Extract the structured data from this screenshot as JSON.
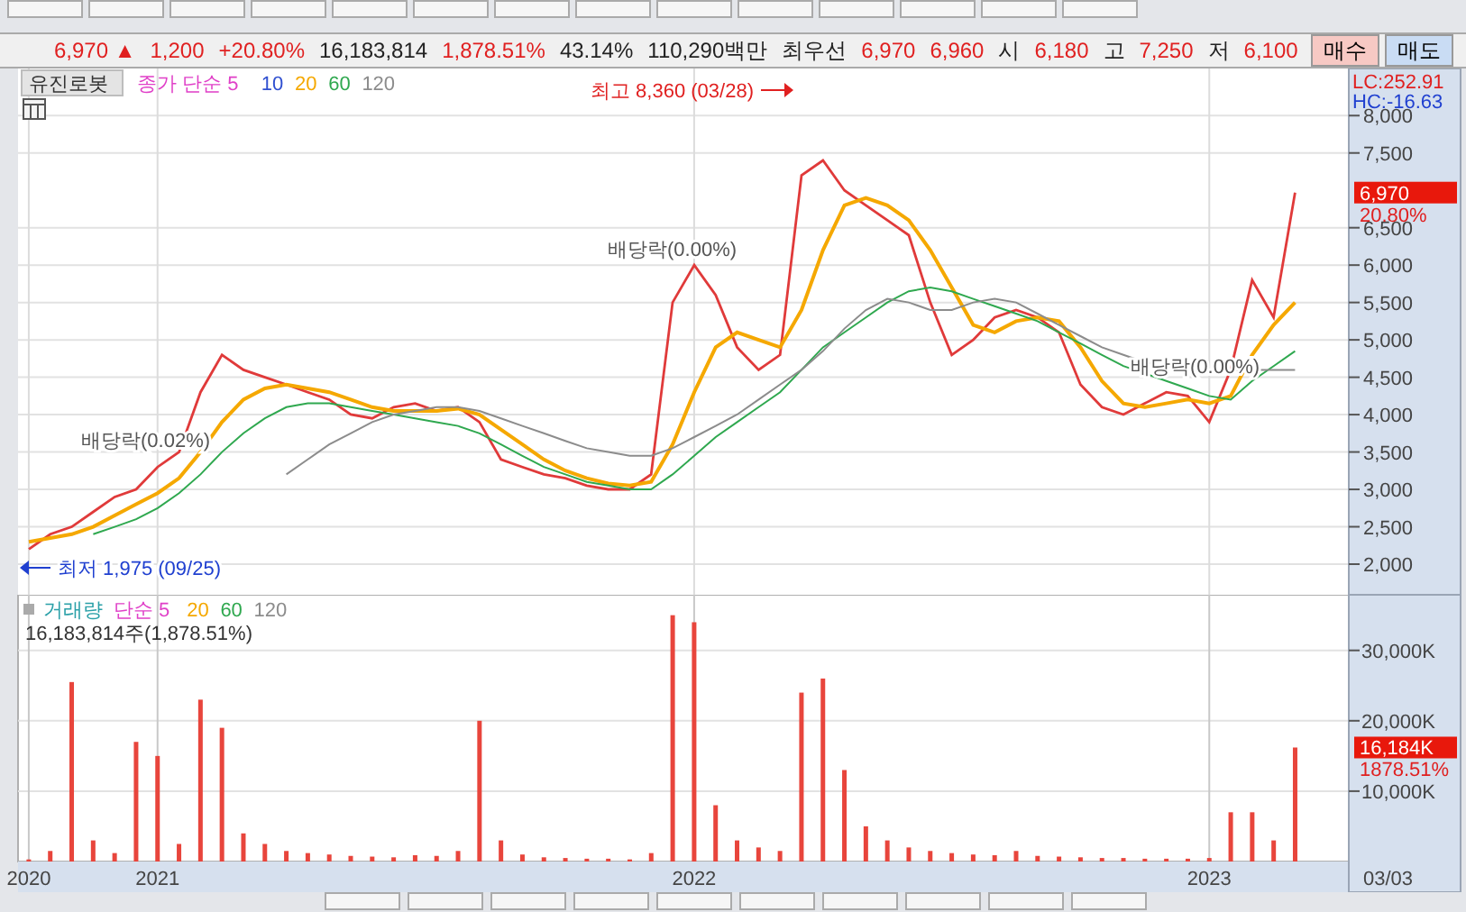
{
  "quote": {
    "price": "6,970",
    "direction": "▲",
    "change": "1,200",
    "change_pct": "+20.80%",
    "volume": "16,183,814",
    "volume_pct": "1,878.51%",
    "turnover": "43.14%",
    "amount": "110,290백만",
    "best_label": "최우선",
    "ask": "6,970",
    "bid": "6,960",
    "open_label": "시",
    "open": "6,180",
    "high_label": "고",
    "high": "7,250",
    "low_label": "저",
    "low": "6,100"
  },
  "buttons": [
    {
      "label": "매수",
      "kind": "buy"
    },
    {
      "label": "매도",
      "kind": "sell"
    }
  ],
  "price_panel": {
    "symbol": "유진로봇",
    "legend": [
      {
        "label": "종가 단순 5",
        "color": "#e040c8"
      },
      {
        "label": "10",
        "color": "#3050d0"
      },
      {
        "label": "20",
        "color": "#f5a800"
      },
      {
        "label": "60",
        "color": "#2fa84f"
      },
      {
        "label": "120",
        "color": "#8c8c8c"
      }
    ],
    "lc": "LC:252.91",
    "hc": "HC:-16.63",
    "last_price_tag": "6,970",
    "last_change_tag": "20.80%",
    "chart_data": {
      "type": "line",
      "grid": true,
      "categories": [
        null,
        null,
        null,
        null,
        null,
        null,
        null,
        null,
        null,
        null,
        null,
        null,
        null,
        null,
        null,
        null,
        null,
        null,
        null,
        null,
        null,
        null,
        null,
        null,
        null,
        null,
        null,
        null,
        null,
        null,
        null,
        null,
        null,
        null,
        null,
        null,
        null,
        null,
        null,
        null,
        null,
        null,
        null,
        null,
        null,
        null,
        null,
        null,
        null,
        null,
        null,
        null,
        null,
        null,
        null,
        null,
        null,
        null,
        null,
        null,
        null,
        null
      ],
      "ylim": [
        1590,
        8630
      ],
      "yticks": [
        {
          "value": 2000,
          "label": "2,000"
        },
        {
          "value": 2500,
          "label": "2,500"
        },
        {
          "value": 3000,
          "label": "3,000"
        },
        {
          "value": 3500,
          "label": "3,500"
        },
        {
          "value": 4000,
          "label": "4,000"
        },
        {
          "value": 4500,
          "label": "4,500"
        },
        {
          "value": 5000,
          "label": "5,000"
        },
        {
          "value": 5500,
          "label": "5,500"
        },
        {
          "value": 6000,
          "label": "6,000"
        },
        {
          "value": 6500,
          "label": "6,500"
        },
        {
          "value": 7500,
          "label": "7,500"
        },
        {
          "value": 8000,
          "label": "8,000"
        }
      ],
      "series": [
        {
          "color": "#e03a3a",
          "values": [
            2200,
            2400,
            2500,
            2700,
            2900,
            3000,
            3300,
            3500,
            4300,
            4800,
            4600,
            4500,
            4400,
            4300,
            4200,
            4000,
            3950,
            4100,
            4150,
            4050,
            4100,
            3900,
            3400,
            3300,
            3200,
            3150,
            3050,
            3000,
            3000,
            3200,
            5500,
            6000,
            5600,
            4900,
            4600,
            4800,
            7200,
            7400,
            7000,
            6800,
            6600,
            6400,
            5500,
            4800,
            5000,
            5300,
            5400,
            5300,
            5100,
            4400,
            4100,
            4000,
            4150,
            4300,
            4250,
            3900,
            4600,
            5800,
            5300,
            6970,
            null,
            null
          ]
        },
        {
          "color": "#f5a800",
          "values": [
            2300,
            2350,
            2400,
            2500,
            2650,
            2800,
            2950,
            3150,
            3500,
            3900,
            4200,
            4350,
            4400,
            4350,
            4300,
            4200,
            4100,
            4050,
            4050,
            4050,
            4080,
            4000,
            3800,
            3600,
            3400,
            3250,
            3150,
            3080,
            3050,
            3100,
            3600,
            4300,
            4900,
            5100,
            5000,
            4900,
            5400,
            6200,
            6800,
            6900,
            6800,
            6600,
            6200,
            5700,
            5200,
            5100,
            5250,
            5300,
            5250,
            4900,
            4450,
            4150,
            4100,
            4150,
            4200,
            4150,
            4250,
            4800,
            5200,
            5500,
            null,
            null
          ]
        },
        {
          "color": "#2fa84f",
          "values": [
            null,
            null,
            null,
            2400,
            2500,
            2600,
            2750,
            2950,
            3200,
            3500,
            3750,
            3950,
            4100,
            4150,
            4150,
            4100,
            4050,
            4000,
            3950,
            3900,
            3850,
            3750,
            3600,
            3450,
            3300,
            3200,
            3100,
            3050,
            3000,
            3000,
            3200,
            3450,
            3700,
            3900,
            4100,
            4300,
            4600,
            4900,
            5100,
            5300,
            5500,
            5650,
            5700,
            5650,
            5550,
            5450,
            5350,
            5250,
            5100,
            4950,
            4800,
            4650,
            4550,
            4450,
            4350,
            4250,
            4200,
            4450,
            4650,
            4850,
            null,
            null
          ]
        },
        {
          "color": "#8c8c8c",
          "values": [
            null,
            null,
            null,
            null,
            null,
            null,
            null,
            null,
            null,
            null,
            null,
            null,
            3200,
            3400,
            3600,
            3750,
            3900,
            4000,
            4050,
            4100,
            4100,
            4050,
            3950,
            3850,
            3750,
            3650,
            3550,
            3500,
            3450,
            3450,
            3550,
            3700,
            3850,
            4000,
            4200,
            4400,
            4600,
            4850,
            5150,
            5400,
            5550,
            5500,
            5400,
            5400,
            5500,
            5550,
            5500,
            5350,
            5200,
            5050,
            4900,
            4800,
            4700,
            4650,
            4600,
            4600,
            4600,
            4600,
            4600,
            4600,
            null,
            null
          ]
        }
      ],
      "annotations": [
        "최고 8,360 (03/28)",
        "최저 1,975 (09/25)",
        "배당락(0.02%)",
        "배당락(0.00%)",
        "배당락(0.00%)"
      ]
    }
  },
  "volume_panel": {
    "legend": [
      {
        "label": "거래량",
        "color": "#2aa0a8"
      },
      {
        "label": "단순 5",
        "color": "#e040c8"
      },
      {
        "label": "20",
        "color": "#f5a800"
      },
      {
        "label": "60",
        "color": "#2fa84f"
      },
      {
        "label": "120",
        "color": "#8c8c8c"
      }
    ],
    "summary": "16,183,814주(1,878.51%)",
    "last_volume_tag": "16,184K",
    "last_pct_tag": "1878.51%",
    "last_date": "03/03",
    "chart_data": {
      "type": "bar",
      "categories": [
        "2020",
        null,
        null,
        null,
        null,
        null,
        "2021",
        null,
        null,
        null,
        null,
        null,
        null,
        null,
        null,
        null,
        null,
        null,
        null,
        null,
        null,
        null,
        null,
        null,
        null,
        null,
        null,
        null,
        null,
        null,
        null,
        "2022",
        null,
        null,
        null,
        null,
        null,
        null,
        null,
        null,
        null,
        null,
        null,
        null,
        null,
        null,
        null,
        null,
        null,
        null,
        null,
        null,
        null,
        null,
        null,
        "2023",
        null,
        null,
        null,
        null,
        null,
        null
      ],
      "grid": true,
      "ylim": [
        0,
        37900
      ],
      "yticks": [
        {
          "value": 10000,
          "label": "10,000K"
        },
        {
          "value": 20000,
          "label": "20,000K"
        },
        {
          "value": 30000,
          "label": "30,000K"
        }
      ],
      "series": [
        {
          "color": "#e8453c",
          "values": [
            300,
            1500,
            25500,
            3000,
            1200,
            17000,
            15000,
            2500,
            23000,
            19000,
            4000,
            2500,
            1500,
            1200,
            1000,
            800,
            700,
            600,
            900,
            800,
            1500,
            20000,
            3000,
            1000,
            600,
            500,
            400,
            400,
            300,
            1200,
            35000,
            34000,
            8000,
            3000,
            2000,
            1500,
            24000,
            26000,
            13000,
            5000,
            3000,
            2000,
            1500,
            1200,
            1000,
            900,
            1500,
            800,
            700,
            600,
            500,
            500,
            400,
            400,
            400,
            500,
            7000,
            7000,
            3000,
            16200,
            null,
            null
          ]
        }
      ]
    }
  }
}
